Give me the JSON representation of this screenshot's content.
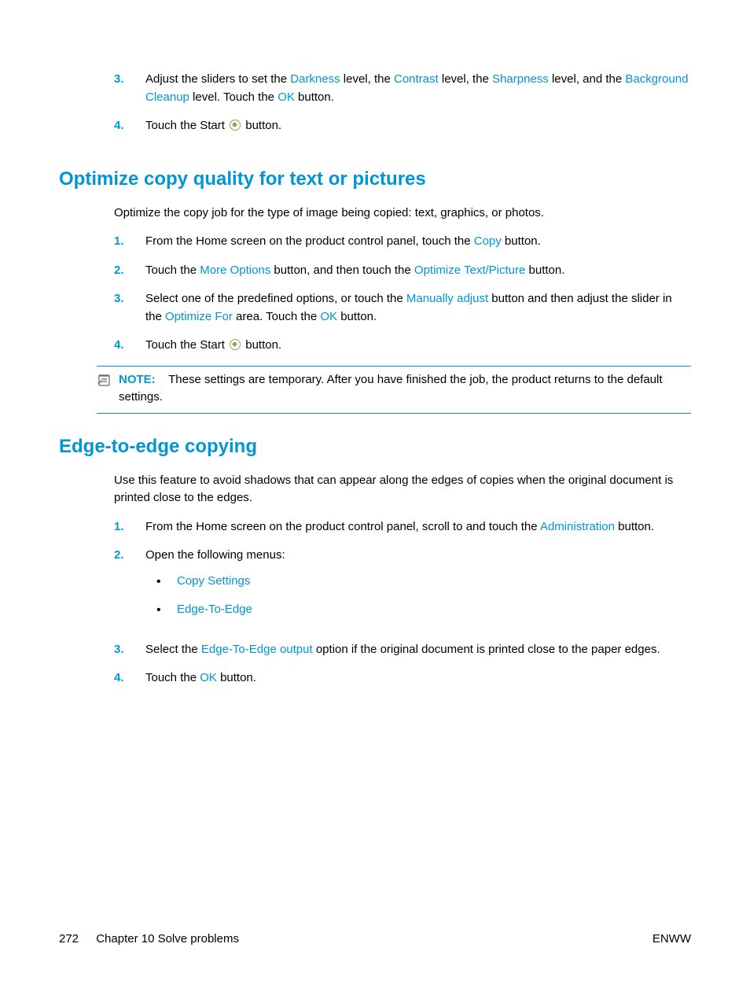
{
  "section0": {
    "step3": {
      "num": "3.",
      "t1": "Adjust the sliders to set the ",
      "darkness": "Darkness",
      "t2": " level, the ",
      "contrast": "Contrast",
      "t3": " level, the ",
      "sharpness": "Sharpness",
      "t4": " level, and the ",
      "bgclean": "Background Cleanup",
      "t5": " level. Touch the ",
      "ok": "OK",
      "t6": " button."
    },
    "step4": {
      "num": "4.",
      "t1": "Touch the Start ",
      "t2": " button."
    }
  },
  "section1": {
    "heading": "Optimize copy quality for text or pictures",
    "intro": "Optimize the copy job for the type of image being copied: text, graphics, or photos.",
    "step1": {
      "num": "1.",
      "t1": "From the Home screen on the product control panel, touch the ",
      "copy": "Copy",
      "t2": " button."
    },
    "step2": {
      "num": "2.",
      "t1": "Touch the ",
      "more": "More Options",
      "t2": " button, and then touch the ",
      "opt": "Optimize Text/Picture",
      "t3": " button."
    },
    "step3": {
      "num": "3.",
      "t1": "Select one of the predefined options, or touch the ",
      "man": "Manually adjust",
      "t2": " button and then adjust the slider in the ",
      "optfor": "Optimize For",
      "t3": " area. Touch the ",
      "ok": "OK",
      "t4": " button."
    },
    "step4": {
      "num": "4.",
      "t1": "Touch the Start ",
      "t2": " button."
    },
    "note": {
      "label": "NOTE:",
      "text": "These settings are temporary. After you have finished the job, the product returns to the default settings."
    }
  },
  "section2": {
    "heading": "Edge-to-edge copying",
    "intro": "Use this feature to avoid shadows that can appear along the edges of copies when the original document is printed close to the edges.",
    "step1": {
      "num": "1.",
      "t1": "From the Home screen on the product control panel, scroll to and touch the ",
      "admin": "Administration",
      "t2": " button."
    },
    "step2": {
      "num": "2.",
      "t1": "Open the following menus:",
      "bul1": "Copy Settings",
      "bul2": "Edge-To-Edge"
    },
    "step3": {
      "num": "3.",
      "t1": "Select the ",
      "e2e": "Edge-To-Edge output",
      "t2": " option if the original document is printed close to the paper edges."
    },
    "step4": {
      "num": "4.",
      "t1": "Touch the ",
      "ok": "OK",
      "t2": " button."
    }
  },
  "footer": {
    "pageno": "272",
    "chapter": "Chapter 10   Solve problems",
    "brand": "ENWW"
  }
}
